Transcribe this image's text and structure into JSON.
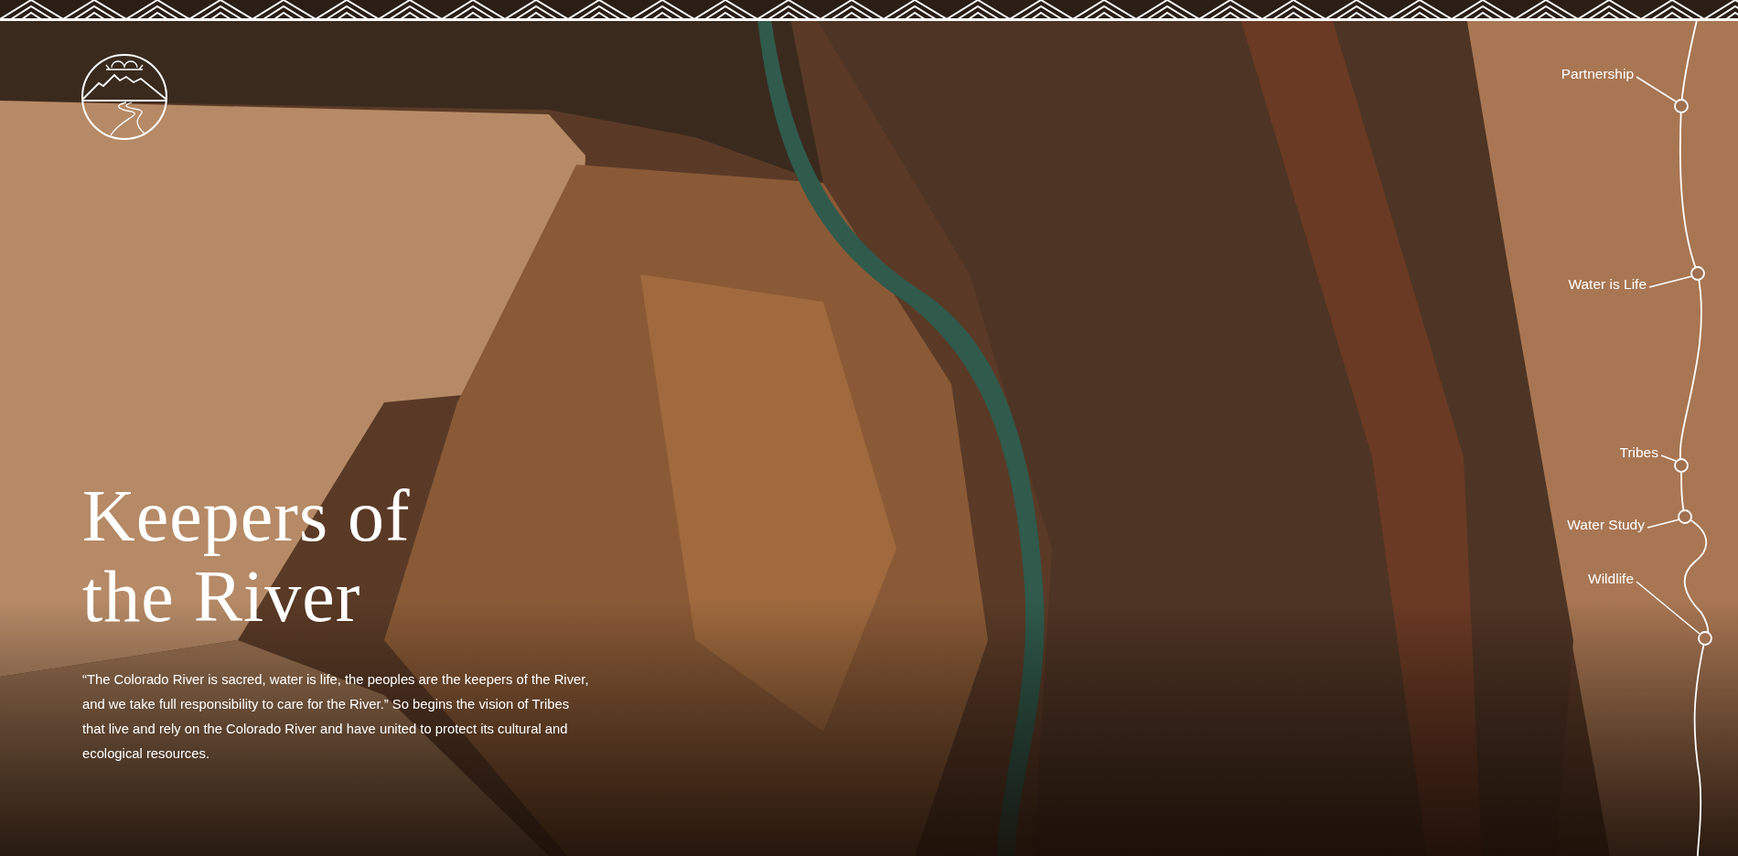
{
  "hero": {
    "title_lines": [
      "Keepers of",
      "the River"
    ],
    "intro": "“The Colorado River is sacred, water is life, the peoples are the keepers of the River, and we take full responsibility to care for the River.” So begins the vision of Tribes that live and rely on the Colorado River and have united to protect its cultural and ecological resources."
  },
  "river_nav": [
    {
      "label": "Partnership"
    },
    {
      "label": "Water is Life"
    },
    {
      "label": "Tribes"
    },
    {
      "label": "Water Study"
    },
    {
      "label": "Wildlife"
    }
  ]
}
